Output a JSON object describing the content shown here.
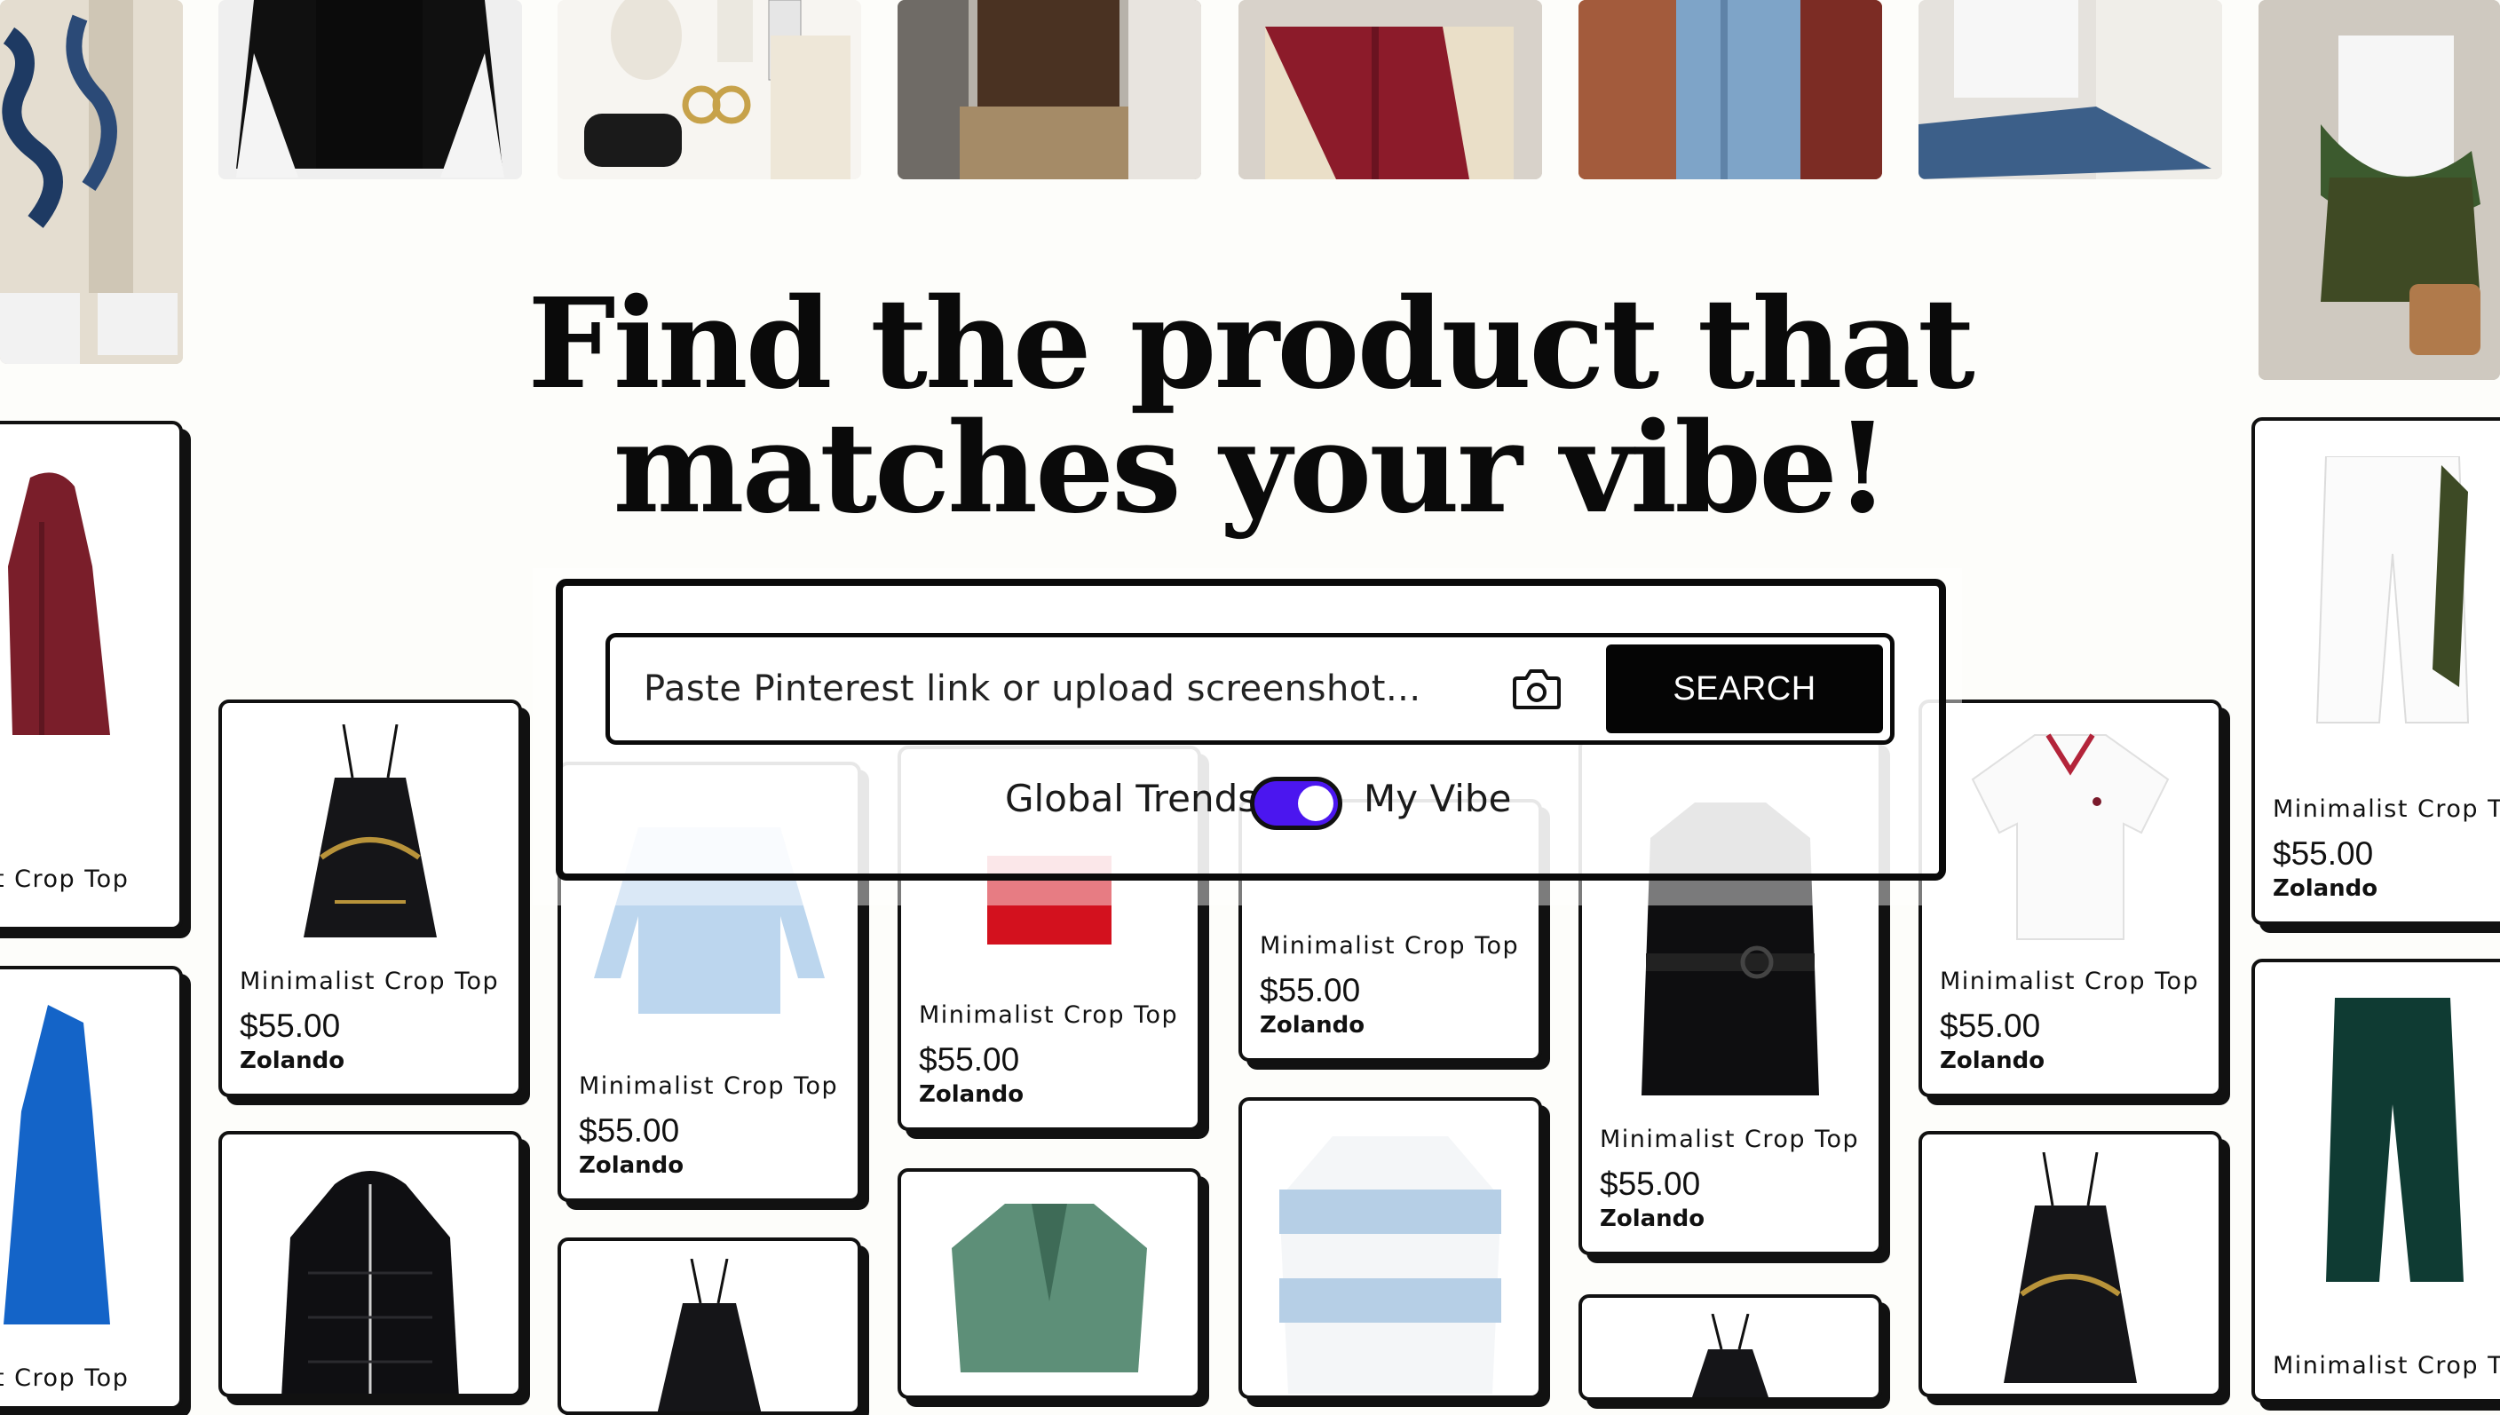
{
  "hero": {
    "line1": "Find the product that",
    "line2": "matches your vibe!"
  },
  "search": {
    "placeholder": "Paste  Pinterest link or  upload screenshot...",
    "camera_icon": "camera-icon",
    "button_label": "SEARCH"
  },
  "toggle": {
    "left_label": "Global Trends",
    "right_label": "My Vibe",
    "state": "on",
    "accent": "#4b16ef"
  },
  "products": [
    {
      "name": "t Crop Top",
      "price": "",
      "store": ""
    },
    {
      "name": "Minimalist Crop Top",
      "price": "$55.00",
      "store": "Zolando"
    },
    {
      "name": "Minimalist Crop Top",
      "price": "$55.00",
      "store": "Zolando"
    },
    {
      "name": "Minimalist Crop Top",
      "price": "$55.00",
      "store": "Zolando"
    },
    {
      "name": "Minimalist Crop Top",
      "price": "$55.00",
      "store": "Zolando"
    },
    {
      "name": "Minimalist Crop Top",
      "price": "$55.00",
      "store": "Zolando"
    },
    {
      "name": "Minimalist Crop Top",
      "price": "$55.00",
      "store": "Zolando"
    },
    {
      "name": "Minimalist Crop Top",
      "price": "$55.00",
      "store": "Zolando"
    },
    {
      "name": "t Crop Top",
      "price": "",
      "store": ""
    },
    {
      "name": "Minimalist Crop Top",
      "price": "",
      "store": ""
    }
  ]
}
